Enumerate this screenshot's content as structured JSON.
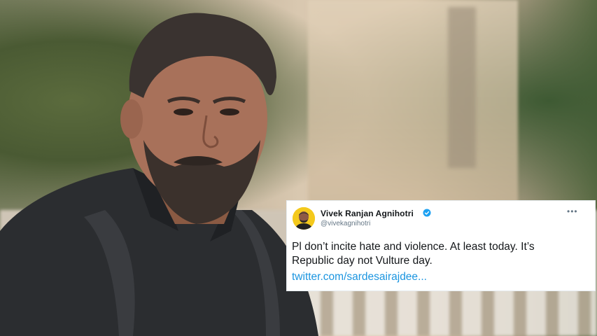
{
  "tweet": {
    "display_name": "Vivek Ranjan Agnihotri",
    "handle": "@vivekagnihotri",
    "more_label": "•••",
    "text_line1": "Pl don’t incite hate and violence. At least today. It’s",
    "text_line2": "Republic day not Vulture day.",
    "link": "twitter.com/sardesairajdee...",
    "colors": {
      "link": "#1b95e0",
      "verified": "#1da1f2",
      "avatar_bg": "#f4c91c"
    }
  },
  "photo": {
    "subject": "bearded-man-black-shirt"
  }
}
